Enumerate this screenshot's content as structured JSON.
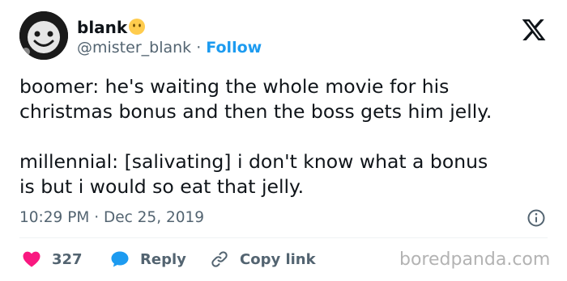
{
  "author": {
    "display_name": "blank",
    "emoji": "no-mouth-face-emoji",
    "handle": "@mister_blank",
    "separator": " · ",
    "follow_label": "Follow"
  },
  "brand_icon": "x-logo-icon",
  "tweet": {
    "text": "boomer: he's waiting the whole movie for his\nchristmas bonus and then the boss gets him jelly.\n\nmillennial: [salivating] i don't know what a bonus\nis but i would so eat that jelly.",
    "time": "10:29 PM",
    "date_separator": " · ",
    "date": "Dec 25, 2019"
  },
  "actions": {
    "like_count": "327",
    "reply_label": "Reply",
    "copy_link_label": "Copy link"
  },
  "watermark": "boredpanda.com",
  "colors": {
    "like": "#f91880",
    "reply": "#1d9bf0",
    "follow": "#1d9bf0",
    "muted": "#536471"
  }
}
